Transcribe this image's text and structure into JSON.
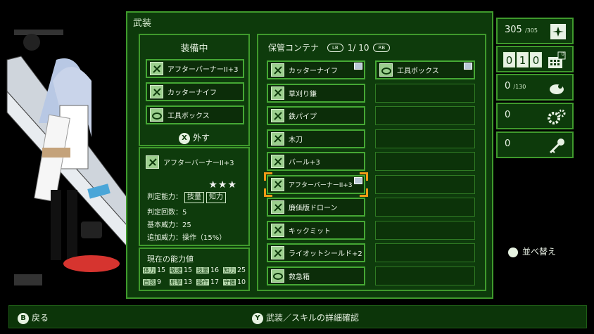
{
  "main_title": "武装",
  "equipped": {
    "title": "装備中",
    "items": [
      {
        "label": "アフターバーナーII+3",
        "icon": "blade-icon"
      },
      {
        "label": "カッターナイフ",
        "icon": "blade-icon"
      },
      {
        "label": "工具ボックス",
        "icon": "toolbox-icon"
      }
    ],
    "remove_button_glyph": "X",
    "remove_label": "外す"
  },
  "detail": {
    "name": "アフターバーナーII+3",
    "stars": "★★★",
    "judge_ability_label": "判定能力：",
    "judge_tags": [
      "技量",
      "知力"
    ],
    "judge_count": "判定回数：5",
    "base_power": "基本威力：25",
    "extra_power": "追加威力：操作（15%）"
  },
  "stats": {
    "title": "現在の能力値",
    "rows": [
      [
        {
          "k": "体力",
          "v": "15"
        },
        {
          "k": "敏捷",
          "v": "15"
        },
        {
          "k": "技量",
          "v": "16"
        },
        {
          "k": "知力",
          "v": "25"
        }
      ],
      [
        {
          "k": "自我",
          "v": "9"
        },
        {
          "k": "射撃",
          "v": "13"
        },
        {
          "k": "操作",
          "v": "17"
        },
        {
          "k": "守備",
          "v": "10"
        }
      ]
    ]
  },
  "storage": {
    "title": "保管コンテナ",
    "lb": "LB",
    "rb": "RB",
    "page": "1/ 10",
    "left_items": [
      {
        "label": "カッターナイフ",
        "icon": "blade-icon",
        "new": true
      },
      {
        "label": "草刈り鎌",
        "icon": "blade-icon"
      },
      {
        "label": "鉄パイプ",
        "icon": "blade-icon"
      },
      {
        "label": "木刀",
        "icon": "blade-icon"
      },
      {
        "label": "バール+3",
        "icon": "blade-icon"
      },
      {
        "label": "アフターバーナーII+3",
        "icon": "blade-icon",
        "new": true,
        "selected": true
      },
      {
        "label": "廉価版ドローン",
        "icon": "blade-icon"
      },
      {
        "label": "キックミット",
        "icon": "blade-icon"
      },
      {
        "label": "ライオットシールド+2",
        "icon": "blade-icon"
      },
      {
        "label": "救急箱",
        "icon": "toolbox-icon"
      }
    ],
    "right_items": [
      {
        "label": "工具ボックス",
        "icon": "toolbox-icon",
        "new": true
      },
      {
        "label": ""
      },
      {
        "label": ""
      },
      {
        "label": ""
      },
      {
        "label": ""
      },
      {
        "label": ""
      },
      {
        "label": ""
      },
      {
        "label": ""
      },
      {
        "label": ""
      },
      {
        "label": ""
      }
    ]
  },
  "resources": {
    "capacity": {
      "value": "305",
      "max": "/305"
    },
    "counter_digits": [
      "0",
      "1",
      "0"
    ],
    "counter_badge": "0",
    "parts": {
      "value": "0",
      "max": "/130"
    },
    "gears": "0",
    "keys": "0"
  },
  "sort_label": "並べ替え",
  "footer": {
    "back_glyph": "B",
    "back_label": "戻る",
    "confirm_glyph": "Y",
    "confirm_label": "武装／スキルの詳細確認"
  },
  "colors": {
    "panel": "#0d3a0b",
    "border": "#3f9a2c",
    "cursor": "#f09a16"
  }
}
